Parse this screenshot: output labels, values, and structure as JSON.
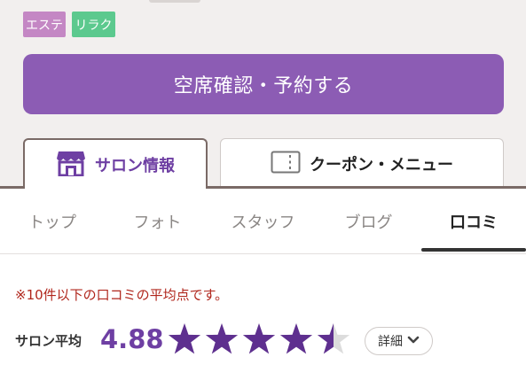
{
  "tags": [
    {
      "label": "エステ",
      "color": "#c487c4"
    },
    {
      "label": "リラク",
      "color": "#5cc98e"
    }
  ],
  "reserve_button": {
    "label": "空席確認・予約する",
    "color": "#8c5cb4"
  },
  "tabs": [
    {
      "label": "サロン情報",
      "icon": "store-icon",
      "active": true
    },
    {
      "label": "クーポン・メニュー",
      "icon": "coupon-icon",
      "active": false
    }
  ],
  "subnav": [
    {
      "label": "トップ",
      "active": false
    },
    {
      "label": "フォト",
      "active": false
    },
    {
      "label": "スタッフ",
      "active": false
    },
    {
      "label": "ブログ",
      "active": false
    },
    {
      "label": "口コミ",
      "active": true
    }
  ],
  "review": {
    "note": "※10件以下の口コミの平均点です。",
    "avg_label": "サロン平均",
    "avg_value": "4.88",
    "rating": 4.88,
    "max_rating": 5,
    "star_color": "#5e2f8f",
    "detail_label": "詳細",
    "detail_icon": "chevron-down-icon"
  }
}
